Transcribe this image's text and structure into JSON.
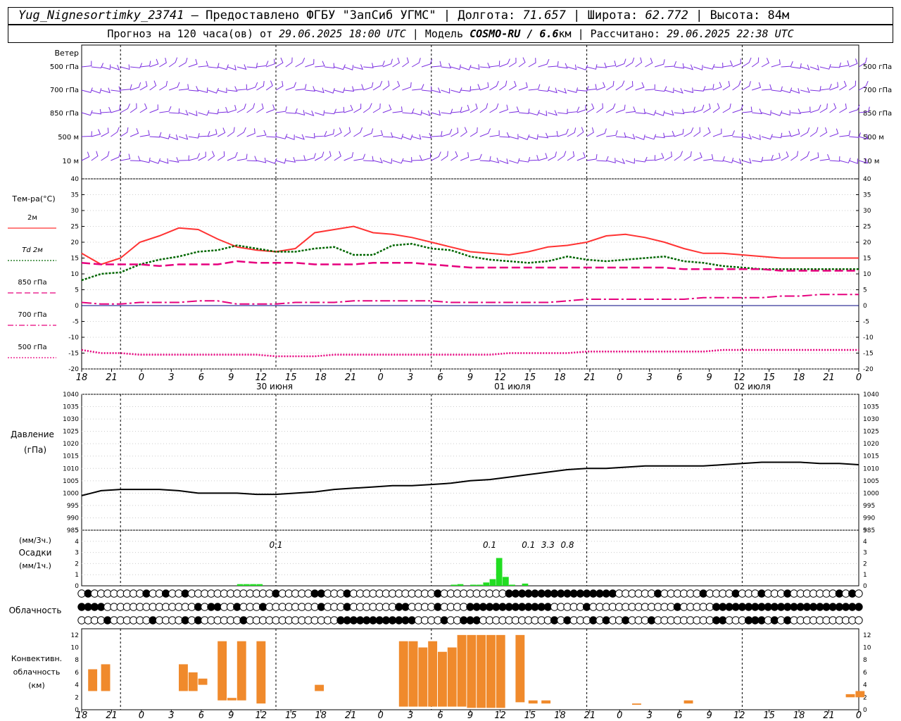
{
  "header": {
    "station": "Yug_Nignesortimky_23741",
    "provided": " — Предоставлено ФГБУ \"ЗапСиб УГМС\" | Долгота: ",
    "lon": "71.657",
    "lat_label": " | Широта: ",
    "lat": "62.772",
    "alt_label": " | Высота: 84м",
    "fc_prefix": "Прогноз на 120 часа(ов) от ",
    "fc_time": "29.06.2025 18:00 UTC",
    "model_label": " | Модель ",
    "model": "COSMO-RU / 6.6",
    "model_unit": "км",
    "calc_label": " | Рассчитано: ",
    "calc_time": "29.06.2025 22:38 UTC"
  },
  "wind": {
    "title": "Ветер",
    "levels": [
      "500 гПа",
      "700 гПа",
      "850 гПа",
      "500 м",
      "10  м"
    ]
  },
  "temperature": {
    "title": "Тем-ра(°С)",
    "legend": [
      {
        "label": "2м",
        "color": "#ff3333",
        "style": "solid"
      },
      {
        "label": "Td  2м",
        "color": "#006600",
        "style": "dot"
      },
      {
        "label": "850 гПа",
        "color": "#e6007e",
        "style": "dash"
      },
      {
        "label": "700 гПа",
        "color": "#e6007e",
        "style": "dashdot"
      },
      {
        "label": "500 гПа",
        "color": "#e6007e",
        "style": "dot"
      }
    ],
    "ticks": [
      "40",
      "35",
      "30",
      "25",
      "20",
      "15",
      "10",
      "5",
      "0",
      "-5",
      "-10",
      "-15",
      "-20"
    ]
  },
  "time_axis": {
    "hours": [
      "18",
      "21",
      "0",
      "3",
      "6",
      "9",
      "12",
      "15",
      "18",
      "21",
      "0",
      "3",
      "6",
      "9",
      "12",
      "15",
      "18",
      "21",
      "0",
      "3",
      "6",
      "9",
      "12",
      "15",
      "18",
      "21",
      "0"
    ],
    "dates": [
      "30 июня",
      "01 июля",
      "02 июля"
    ]
  },
  "pressure": {
    "title1": "Давление",
    "title2": "(гПа)",
    "ticks": [
      "1040",
      "1035",
      "1030",
      "1025",
      "1020",
      "1015",
      "1010",
      "1005",
      "1000",
      "995",
      "990",
      "985"
    ]
  },
  "precip": {
    "units1": "(мм/3ч.)",
    "title": "Осадки",
    "units2": "(мм/1ч.)",
    "ticks": [
      "5",
      "4",
      "3",
      "2",
      "1",
      "0"
    ],
    "labels": [
      {
        "text": "0.1",
        "x": 30
      },
      {
        "text": "0.1",
        "x": 63
      },
      {
        "text": "0.1",
        "x": 69
      },
      {
        "text": "3.3",
        "x": 72
      },
      {
        "text": "0.8",
        "x": 75
      }
    ]
  },
  "cloud": {
    "title": "Облачность"
  },
  "convective": {
    "title1": "Конвективн.",
    "title2": "облачность",
    "title3": "(км)",
    "ticks": [
      "12",
      "10",
      "8",
      "6",
      "4",
      "2",
      "0"
    ]
  },
  "chart_data": [
    {
      "type": "line",
      "title": "Тем-ра(°С)",
      "ylim": [
        -20,
        40
      ],
      "x_hours": [
        0,
        3,
        6,
        9,
        12,
        15,
        18,
        21,
        24,
        27,
        30,
        33,
        36,
        39,
        42,
        45,
        48,
        51,
        54,
        57,
        60,
        63,
        66,
        69,
        72,
        75,
        78,
        81,
        84,
        87,
        90,
        93,
        96,
        99,
        102,
        105,
        108,
        111,
        114,
        117,
        120
      ],
      "series": [
        {
          "name": "2м",
          "values": [
            16.5,
            13,
            15,
            20,
            22,
            24.5,
            24,
            21,
            18.5,
            17.5,
            17,
            18,
            23,
            24,
            25,
            23,
            22.5,
            21.5,
            20,
            18.5,
            17,
            16.5,
            16,
            17,
            18.5,
            19,
            20,
            22,
            22.5,
            21.5,
            20,
            18,
            16.5,
            16.5,
            16,
            15.5,
            15,
            15,
            15,
            15,
            15
          ]
        },
        {
          "name": "Td  2м",
          "values": [
            8,
            10,
            10.5,
            13,
            14.5,
            15.5,
            17,
            17.5,
            19,
            18,
            17,
            17,
            18,
            18.5,
            16,
            16,
            19,
            19.5,
            18,
            17.5,
            15.5,
            14.5,
            14,
            13.5,
            14,
            15.5,
            14.5,
            14,
            14.5,
            15,
            15.5,
            14,
            13.5,
            12.5,
            12,
            11.5,
            11.5,
            11.5,
            11.5,
            11.5,
            11.5
          ]
        },
        {
          "name": "850 гПа",
          "values": [
            13.5,
            13,
            13,
            13,
            12.5,
            13,
            13,
            13,
            14,
            13.5,
            13.5,
            13.5,
            13,
            13,
            13,
            13.5,
            13.5,
            13.5,
            13,
            12.5,
            12,
            12,
            12,
            12,
            12,
            12,
            12,
            12,
            12,
            12,
            12,
            11.5,
            11.5,
            11.5,
            11.5,
            11.5,
            11,
            11,
            11,
            11,
            11
          ]
        },
        {
          "name": "700 гПа",
          "values": [
            1,
            0.5,
            0.5,
            1,
            1,
            1,
            1.5,
            1.5,
            0.5,
            0.5,
            0.5,
            1,
            1,
            1,
            1.5,
            1.5,
            1.5,
            1.5,
            1.5,
            1,
            1,
            1,
            1,
            1,
            1,
            1.5,
            2,
            2,
            2,
            2,
            2,
            2,
            2.5,
            2.5,
            2.5,
            2.5,
            3,
            3,
            3.5,
            3.5,
            3.5
          ]
        },
        {
          "name": "500 гПа",
          "values": [
            -14,
            -15,
            -15,
            -15.5,
            -15.5,
            -15.5,
            -15.5,
            -15.5,
            -15.5,
            -15.5,
            -16,
            -16,
            -16,
            -15.5,
            -15.5,
            -15.5,
            -15.5,
            -15.5,
            -15.5,
            -15.5,
            -15.5,
            -15.5,
            -15,
            -15,
            -15,
            -15,
            -14.5,
            -14.5,
            -14.5,
            -14.5,
            -14.5,
            -14.5,
            -14.5,
            -14,
            -14,
            -14,
            -14,
            -14,
            -14,
            -14,
            -14
          ]
        }
      ]
    },
    {
      "type": "line",
      "title": "Давление",
      "ylim": [
        985,
        1040
      ],
      "x_hours": [
        0,
        3,
        6,
        9,
        12,
        15,
        18,
        21,
        24,
        27,
        30,
        33,
        36,
        39,
        42,
        45,
        48,
        51,
        54,
        57,
        60,
        63,
        66,
        69,
        72,
        75,
        78,
        81,
        84,
        87,
        90,
        93,
        96,
        99,
        102,
        105,
        108,
        111,
        114,
        117,
        120
      ],
      "series": [
        {
          "name": "",
          "values": [
            999,
            1001,
            1001.5,
            1001.5,
            1001.5,
            1001,
            1000,
            1000,
            1000,
            999.5,
            999.5,
            1000,
            1000.5,
            1001.5,
            1002,
            1002.5,
            1003,
            1003,
            1003.5,
            1004,
            1005,
            1005.5,
            1006.5,
            1007.5,
            1008.5,
            1009.5,
            1010,
            1010,
            1010.5,
            1011,
            1011,
            1011,
            1011,
            1011.5,
            1012,
            1012.5,
            1012.5,
            1012.5,
            1012,
            1012,
            1011.5
          ]
        }
      ]
    },
    {
      "type": "bar",
      "title": "Осадки",
      "ylim": [
        0,
        5
      ],
      "x_hours": [
        24,
        25,
        26,
        27,
        57,
        58,
        60,
        61,
        62,
        63,
        64,
        65,
        66,
        68
      ],
      "values": [
        0.15,
        0.15,
        0.15,
        0.15,
        0.1,
        0.15,
        0.1,
        0.1,
        0.3,
        0.6,
        2.5,
        0.8,
        0.1,
        0.2
      ]
    },
    {
      "type": "bar",
      "title": "Конвективн. облачность (км)",
      "ylim": [
        0,
        13
      ],
      "bars": [
        {
          "x": 1,
          "bottom": 3,
          "top": 6.5
        },
        {
          "x": 3,
          "bottom": 3,
          "top": 7.3
        },
        {
          "x": 15,
          "bottom": 3,
          "top": 7.3
        },
        {
          "x": 16.5,
          "bottom": 3,
          "top": 6
        },
        {
          "x": 18,
          "bottom": 4,
          "top": 5
        },
        {
          "x": 21,
          "bottom": 1.5,
          "top": 11
        },
        {
          "x": 22.5,
          "bottom": 1.5,
          "top": 1.9
        },
        {
          "x": 24,
          "bottom": 1.5,
          "top": 11
        },
        {
          "x": 27,
          "bottom": 1.0,
          "top": 11
        },
        {
          "x": 36,
          "bottom": 3,
          "top": 4
        },
        {
          "x": 49,
          "bottom": 0.5,
          "top": 11
        },
        {
          "x": 50.5,
          "bottom": 0.5,
          "top": 11
        },
        {
          "x": 52,
          "bottom": 0.5,
          "top": 10
        },
        {
          "x": 53.5,
          "bottom": 0.5,
          "top": 11
        },
        {
          "x": 55,
          "bottom": 0.5,
          "top": 9.3
        },
        {
          "x": 56.5,
          "bottom": 0.5,
          "top": 10
        },
        {
          "x": 58,
          "bottom": 0.5,
          "top": 12
        },
        {
          "x": 59.5,
          "bottom": 0.3,
          "top": 12
        },
        {
          "x": 61,
          "bottom": 0.3,
          "top": 12
        },
        {
          "x": 62.5,
          "bottom": 0.3,
          "top": 12
        },
        {
          "x": 64,
          "bottom": 0.3,
          "top": 12
        },
        {
          "x": 67,
          "bottom": 1.2,
          "top": 12
        },
        {
          "x": 69,
          "bottom": 1.0,
          "top": 1.5
        },
        {
          "x": 71,
          "bottom": 1.0,
          "top": 1.5
        },
        {
          "x": 85,
          "bottom": 0.8,
          "top": 1.0
        },
        {
          "x": 93,
          "bottom": 1.0,
          "top": 1.5
        },
        {
          "x": 118,
          "bottom": 2.0,
          "top": 2.5
        },
        {
          "x": 119.5,
          "bottom": 2.0,
          "top": 3.0
        }
      ]
    }
  ]
}
